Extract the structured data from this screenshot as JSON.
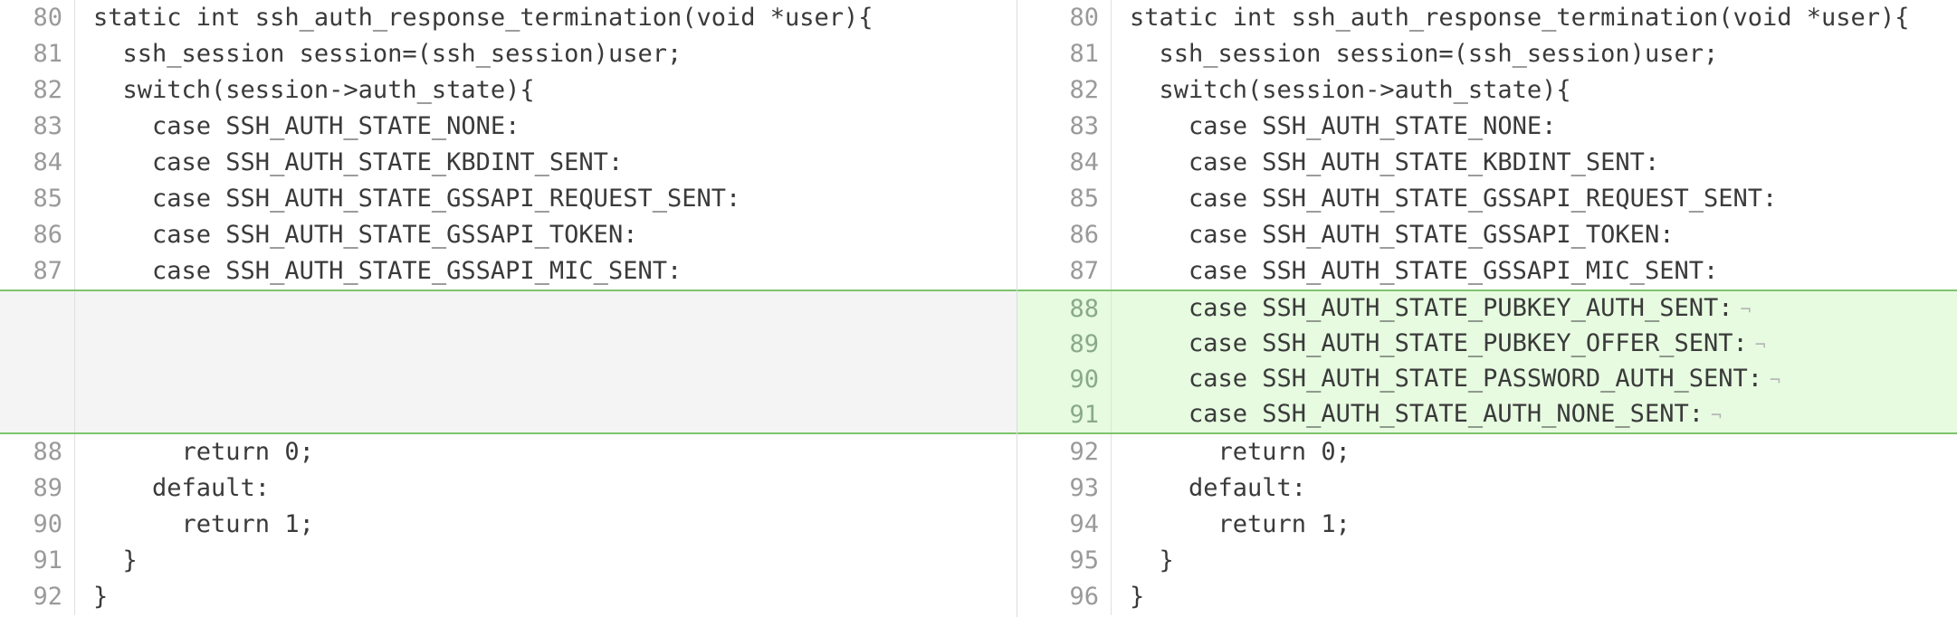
{
  "left": {
    "before": [
      {
        "num": "80",
        "text": "static int ssh_auth_response_termination(void *user){"
      },
      {
        "num": "81",
        "text": "  ssh_session session=(ssh_session)user;"
      },
      {
        "num": "82",
        "text": "  switch(session->auth_state){"
      },
      {
        "num": "83",
        "text": "    case SSH_AUTH_STATE_NONE:"
      },
      {
        "num": "84",
        "text": "    case SSH_AUTH_STATE_KBDINT_SENT:"
      },
      {
        "num": "85",
        "text": "    case SSH_AUTH_STATE_GSSAPI_REQUEST_SENT:"
      },
      {
        "num": "86",
        "text": "    case SSH_AUTH_STATE_GSSAPI_TOKEN:"
      },
      {
        "num": "87",
        "text": "    case SSH_AUTH_STATE_GSSAPI_MIC_SENT:"
      }
    ],
    "after": [
      {
        "num": "88",
        "text": "      return 0;"
      },
      {
        "num": "89",
        "text": "    default:"
      },
      {
        "num": "90",
        "text": "      return 1;"
      },
      {
        "num": "91",
        "text": "  }"
      },
      {
        "num": "92",
        "text": "}"
      }
    ]
  },
  "right": {
    "before": [
      {
        "num": "80",
        "text": "static int ssh_auth_response_termination(void *user){"
      },
      {
        "num": "81",
        "text": "  ssh_session session=(ssh_session)user;"
      },
      {
        "num": "82",
        "text": "  switch(session->auth_state){"
      },
      {
        "num": "83",
        "text": "    case SSH_AUTH_STATE_NONE:"
      },
      {
        "num": "84",
        "text": "    case SSH_AUTH_STATE_KBDINT_SENT:"
      },
      {
        "num": "85",
        "text": "    case SSH_AUTH_STATE_GSSAPI_REQUEST_SENT:"
      },
      {
        "num": "86",
        "text": "    case SSH_AUTH_STATE_GSSAPI_TOKEN:"
      },
      {
        "num": "87",
        "text": "    case SSH_AUTH_STATE_GSSAPI_MIC_SENT:"
      }
    ],
    "added": [
      {
        "num": "88",
        "text": "    case SSH_AUTH_STATE_PUBKEY_AUTH_SENT:"
      },
      {
        "num": "89",
        "text": "    case SSH_AUTH_STATE_PUBKEY_OFFER_SENT:"
      },
      {
        "num": "90",
        "text": "    case SSH_AUTH_STATE_PASSWORD_AUTH_SENT:"
      },
      {
        "num": "91",
        "text": "    case SSH_AUTH_STATE_AUTH_NONE_SENT:"
      }
    ],
    "after": [
      {
        "num": "92",
        "text": "      return 0;"
      },
      {
        "num": "93",
        "text": "    default:"
      },
      {
        "num": "94",
        "text": "      return 1;"
      },
      {
        "num": "95",
        "text": "  }"
      },
      {
        "num": "96",
        "text": "}"
      }
    ]
  },
  "markers": {
    "line_end": "¬"
  },
  "colors": {
    "added_bg": "#e6fbe0",
    "added_border": "#7ec46d",
    "placeholder_bg": "#f4f4f4",
    "line_number": "#9a9a9a",
    "code_text": "#3a3a3a"
  }
}
